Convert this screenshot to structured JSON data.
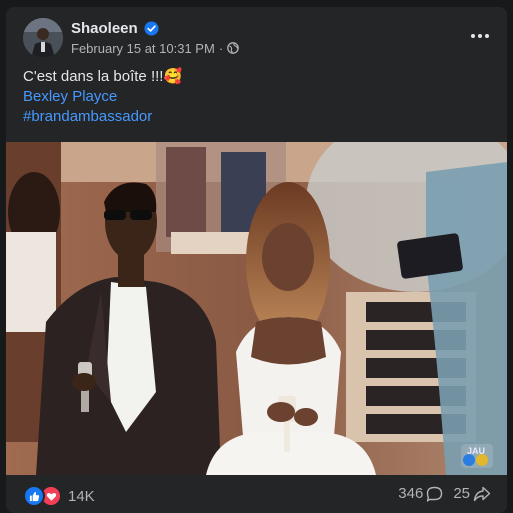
{
  "post": {
    "author": "Shaoleen",
    "timestamp": "February 15 at 10:31 PM",
    "separator": "·",
    "privacy_icon": "globe-icon",
    "verified_icon": "verified-badge-icon",
    "more_icon": "more-options-icon"
  },
  "content": {
    "text": "C'est dans la boîte !!!🥰",
    "location_link": "Bexley Playce",
    "hashtag": "#brandambassador"
  },
  "photo": {
    "watermark": "JAU"
  },
  "footer": {
    "reaction_count": "14K",
    "comment_count": "346",
    "share_count": "25",
    "reaction_icons": [
      "like-icon",
      "love-icon"
    ]
  },
  "colors": {
    "background": "#18191a",
    "card": "#242526",
    "text_primary": "#e4e6eb",
    "text_secondary": "#b0b3b8",
    "link": "#4599ff",
    "like": "#1877f2",
    "love": "#f33e58"
  }
}
